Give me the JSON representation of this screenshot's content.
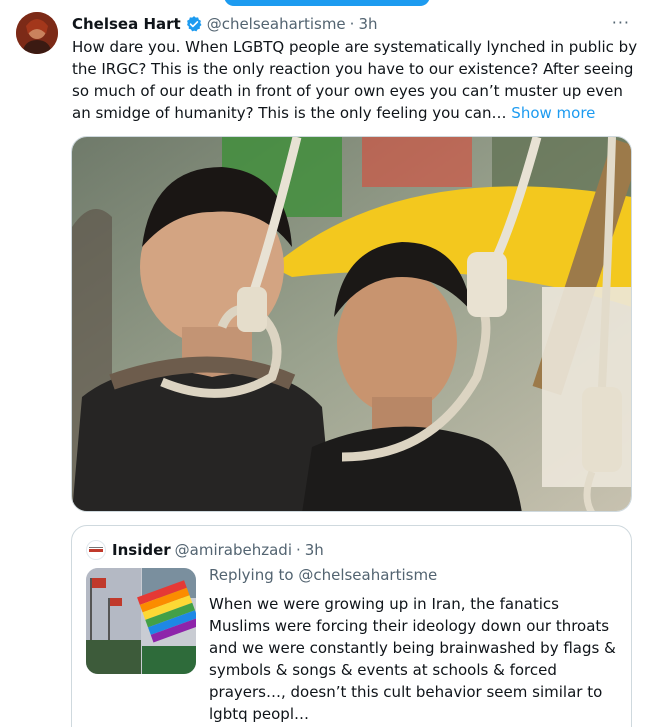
{
  "tweet": {
    "author_name": "Chelsea Hart",
    "handle": "@chelseahartisme",
    "separator": "·",
    "time": "3h",
    "more_label": "···",
    "text": "How dare you. When LGBTQ people are systematically lynched in public by the IRGC? This is the only reaction you have to our existence? After seeing so much of our death in front of your own eyes you can’t muster up even an smidge of humanity? This is the only feeling you can…",
    "show_more": "Show more",
    "icons": {
      "verified": "verified-badge-icon",
      "more": "more-options-icon"
    }
  },
  "quote": {
    "author_name": "Insider",
    "handle": "@amirabehzadi",
    "separator": "·",
    "time": "3h",
    "avatar_label": "Insider Iran",
    "replying_to": "Replying to @chelseahartisme",
    "text": "When we were growing up in Iran, the fanatics Muslims were forcing their ideology down our throats and we were constantly being brainwashed by flags & symbols & songs & events at schools & forced prayers…, doesn’t this cult behavior seem similar to lgbtq peopl…"
  },
  "colors": {
    "accent": "#1d9bf0",
    "text": "#0f1419",
    "muted": "#536471",
    "border": "#cfd9de"
  }
}
